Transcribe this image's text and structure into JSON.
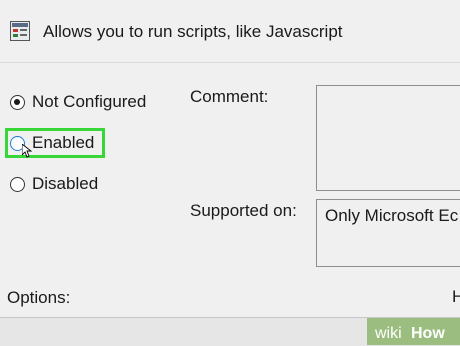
{
  "header": {
    "title": "Allows you to run scripts, like Javascript"
  },
  "state_options": [
    {
      "label": "Not Configured",
      "checked": true
    },
    {
      "label": "Enabled",
      "checked": false,
      "highlighted": true
    },
    {
      "label": "Disabled",
      "checked": false
    }
  ],
  "comment": {
    "label": "Comment:",
    "value": ""
  },
  "supported_on": {
    "label": "Supported on:",
    "value": "Only Microsoft Ec"
  },
  "options": {
    "label": "Options:",
    "help_label_partial": "H"
  },
  "watermark": {
    "text_wiki": "wiki",
    "text_how": "How"
  },
  "colors": {
    "highlight_green": "#38d638",
    "window_bg": "#f0f0f0",
    "watermark_green": "#93b874"
  }
}
